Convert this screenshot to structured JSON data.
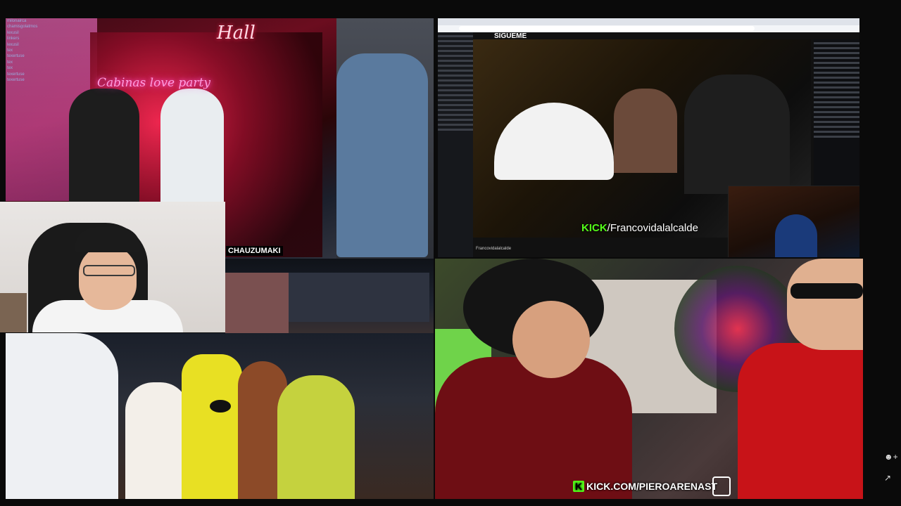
{
  "tiles": {
    "party": {
      "sign_text": "Cabinas love party",
      "hall_text": "Hall",
      "watermark": "CHAUZUMAKI",
      "chat_users": [
        "milonairca",
        "chamisgolatmos",
        "lexusil",
        "linkers",
        "lexusil",
        "tex",
        "texertuse",
        "tex",
        "tex",
        "texertuse",
        "texertuse"
      ]
    },
    "browser": {
      "follow_text": "SIGUEME",
      "kick_prefix": "KICK",
      "kick_handle": "/Francovidalalcalde",
      "channel": "Francovidalalcalde"
    },
    "bottom_right": {
      "kick_badge": "K",
      "kick_url": "KICK.COM/PIEROARENAST"
    }
  },
  "side_icons": [
    "add-user-icon",
    "share-icon"
  ]
}
